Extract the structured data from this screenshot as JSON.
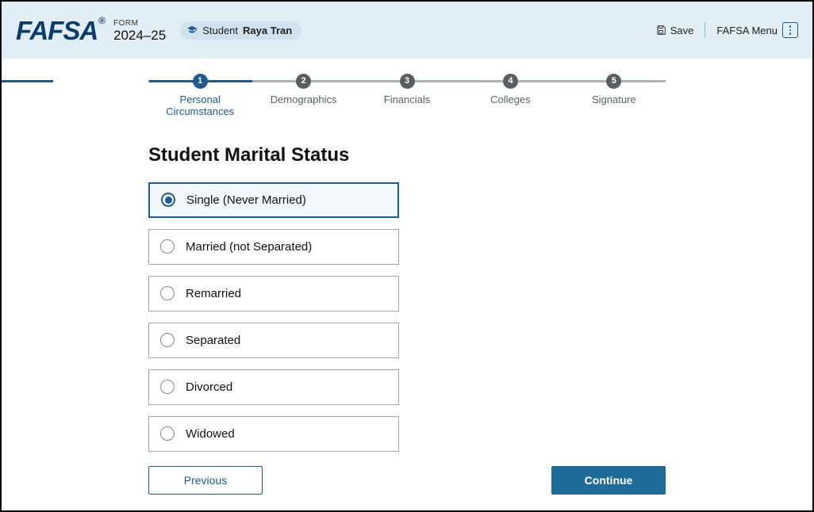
{
  "header": {
    "logo_text": "FAFSA",
    "logo_reg": "®",
    "form_label": "FORM",
    "year": "2024–25",
    "student_prefix": "Student",
    "student_name": "Raya Tran",
    "save_label": "Save",
    "menu_label": "FAFSA Menu"
  },
  "stepper": {
    "steps": [
      {
        "num": "1",
        "label": "Personal Circumstances",
        "active": true
      },
      {
        "num": "2",
        "label": "Demographics",
        "active": false
      },
      {
        "num": "3",
        "label": "Financials",
        "active": false
      },
      {
        "num": "4",
        "label": "Colleges",
        "active": false
      },
      {
        "num": "5",
        "label": "Signature",
        "active": false
      }
    ]
  },
  "page": {
    "heading": "Student Marital Status"
  },
  "options": [
    {
      "label": "Single (Never Married)",
      "selected": true
    },
    {
      "label": "Married (not Separated)",
      "selected": false
    },
    {
      "label": "Remarried",
      "selected": false
    },
    {
      "label": "Separated",
      "selected": false
    },
    {
      "label": "Divorced",
      "selected": false
    },
    {
      "label": "Widowed",
      "selected": false
    }
  ],
  "footer": {
    "previous": "Previous",
    "continue": "Continue"
  }
}
